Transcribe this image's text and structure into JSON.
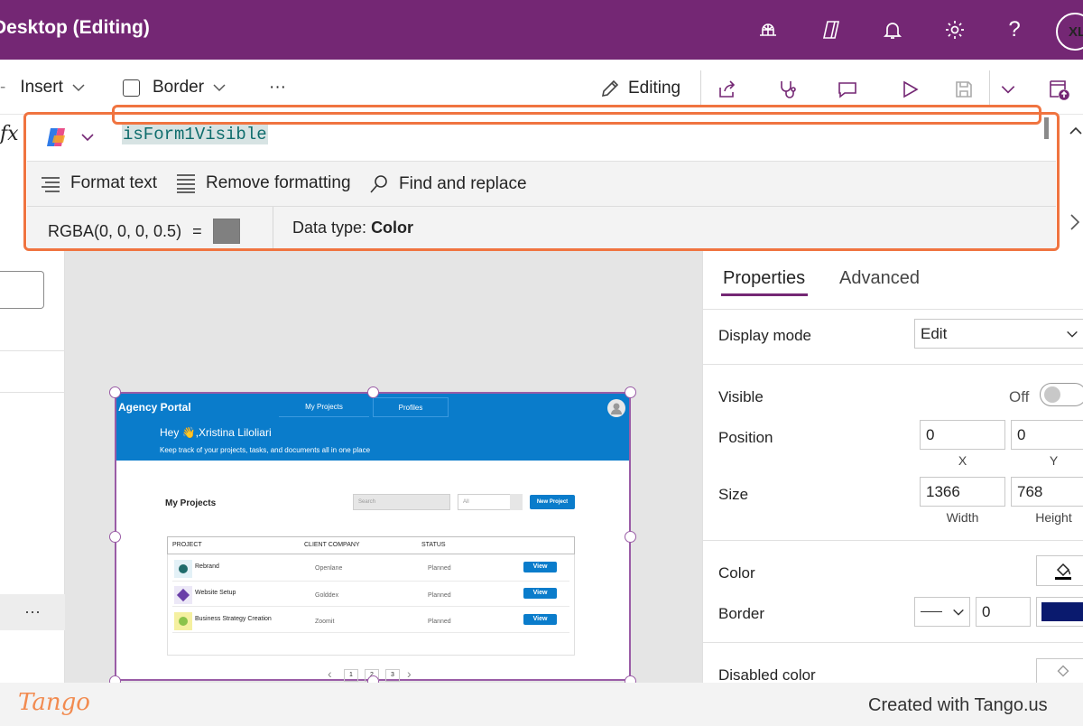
{
  "titlebar": {
    "title": "Desktop (Editing)",
    "avatar": "XL",
    "help": "?"
  },
  "command_bar": {
    "insert": "Insert",
    "border": "Border",
    "more": "···",
    "editing": "Editing"
  },
  "formula_bar": {
    "fx": "fx",
    "formula": "isForm1Visible",
    "format_text": "Format text",
    "remove_formatting": "Remove formatting",
    "find_replace": "Find and replace",
    "result_value": "RGBA(0, 0, 0, 0.5)",
    "equals": "=",
    "data_type_label": "Data type:",
    "data_type_value": "Color"
  },
  "left_pane": {
    "more": "···"
  },
  "preview": {
    "app_title": "Agency Portal",
    "tab_projects": "My Projects",
    "tab_profiles": "Profiles",
    "greeting": "Hey  👋,Xristina Liloliari",
    "subtitle": "Keep track of your projects, tasks, and documents all in one place",
    "section_title": "My Projects",
    "search_placeholder": "Search",
    "filter_value": "All",
    "new_project": "New Project",
    "columns": [
      "PROJECT",
      "CLIENT COMPANY",
      "STATUS"
    ],
    "rows": [
      {
        "project": "Rebrand",
        "client": "Openlane",
        "status": "Planned",
        "action": "View",
        "icon_color": "#1f6b6b"
      },
      {
        "project": "Website Setup",
        "client": "Golddex",
        "status": "Planned",
        "action": "View",
        "icon_color": "#6a3fa8"
      },
      {
        "project": "Business Strategy Creation",
        "client": "Zoomit",
        "status": "Planned",
        "action": "View",
        "icon_color": "#8bc34a"
      }
    ],
    "pages": [
      "1",
      "2",
      "3"
    ]
  },
  "properties": {
    "tab_properties": "Properties",
    "tab_advanced": "Advanced",
    "display_mode_label": "Display mode",
    "display_mode_value": "Edit",
    "visible_label": "Visible",
    "visible_value": "Off",
    "position_label": "Position",
    "position_x": "0",
    "position_y": "0",
    "x_label": "X",
    "y_label": "Y",
    "size_label": "Size",
    "width_value": "1366",
    "height_value": "768",
    "width_label": "Width",
    "height_label": "Height",
    "color_label": "Color",
    "border_label": "Border",
    "border_width": "0",
    "disabled_color_label": "Disabled color",
    "border_color": "#0a1a6e"
  },
  "footer": {
    "logo": "Tango",
    "text": "Created with Tango.us"
  },
  "colors": {
    "brand": "#742774",
    "highlight": "#f07440",
    "app_blue": "#0a7ccb"
  }
}
